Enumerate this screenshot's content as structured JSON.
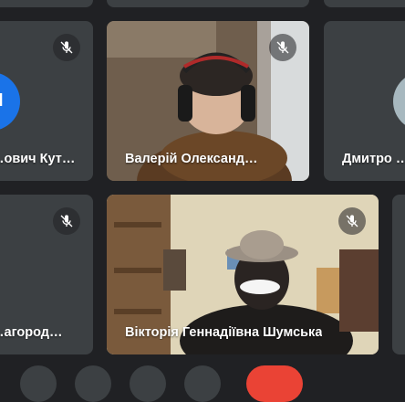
{
  "participants": [
    {
      "name": "…ович Кут…",
      "muted": true,
      "avatar_color": "#1a73e8"
    },
    {
      "name": "Валерій Олександ…",
      "muted": true
    },
    {
      "name": "Дмитро …",
      "muted": false,
      "avatar_color": "#a7b8bf"
    },
    {
      "name": "…агород…",
      "muted": true
    },
    {
      "name": "Вікторія Геннадіївна Шумська",
      "muted": true
    }
  ],
  "colors": {
    "background": "#202124",
    "tile": "#3c4043",
    "end_call": "#ea4335"
  },
  "icons": {
    "mic_off": "mic-off-icon"
  }
}
